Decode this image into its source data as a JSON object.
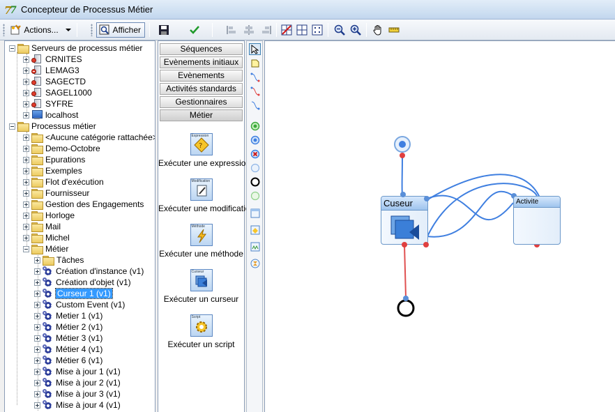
{
  "window": {
    "title": "Concepteur de Processus Métier"
  },
  "toolbar": {
    "actions_label": "Actions...",
    "afficher_label": "Afficher",
    "icons": [
      "save-icon",
      "validate-check-icon",
      "align-left-icon",
      "align-center-icon",
      "align-right-icon",
      "remove-grid-icon",
      "grid-icon",
      "snap-grid-icon",
      "zoom-out-icon",
      "zoom-in-icon",
      "pan-hand-icon",
      "ruler-icon"
    ]
  },
  "tree": {
    "servers_label": "Serveurs de processus métier",
    "servers": [
      "CRNITES",
      "LEMAG3",
      "SAGECTD",
      "SAGEL1000",
      "SYFRE",
      "localhost"
    ],
    "processes_label": "Processus métier",
    "categories": [
      "<Aucune catégorie rattachée>",
      "Demo-Octobre",
      "Epurations",
      "Exemples",
      "Flot d'exécution",
      "Fournisseur",
      "Gestion des Engagements",
      "Horloge",
      "Mail",
      "Michel",
      "Métier"
    ],
    "metier_children": [
      "Tâches",
      "Création d'instance (v1)",
      "Création d'objet (v1)",
      "Curseur 1 (v1)",
      "Custom Event (v1)",
      "Metier 1 (v1)",
      "Métier 2 (v1)",
      "Métier 3 (v1)",
      "Métier 4 (v1)",
      "Métier 6 (v1)",
      "Mise à jour 1 (v1)",
      "Mise à jour 2 (v1)",
      "Mise à jour 3 (v1)",
      "Mise à jour 4 (v1)"
    ],
    "selected": "Curseur 1 (v1)"
  },
  "palette": {
    "categories": [
      "Séquences",
      "Evènements initiaux",
      "Evènements",
      "Activités standards",
      "Gestionnaires",
      "Métier"
    ],
    "active_category": "Métier",
    "items": [
      {
        "label": "Exécuter une expression",
        "caption": "Expression"
      },
      {
        "label": "Exécuter une modification",
        "caption": "Modification"
      },
      {
        "label": "Exécuter une méthode",
        "caption": "Méthode"
      },
      {
        "label": "Exécuter un curseur",
        "caption": "Curseur"
      },
      {
        "label": "Exécuter un script",
        "caption": "Script"
      }
    ]
  },
  "canvas": {
    "nodes": [
      {
        "label": "Cuseur"
      },
      {
        "label": "Activite"
      }
    ],
    "colors": {
      "link": "#3f7fe0",
      "end_link": "#e05050",
      "port_red": "#e04040",
      "port_blue": "#5a8fd8"
    }
  }
}
